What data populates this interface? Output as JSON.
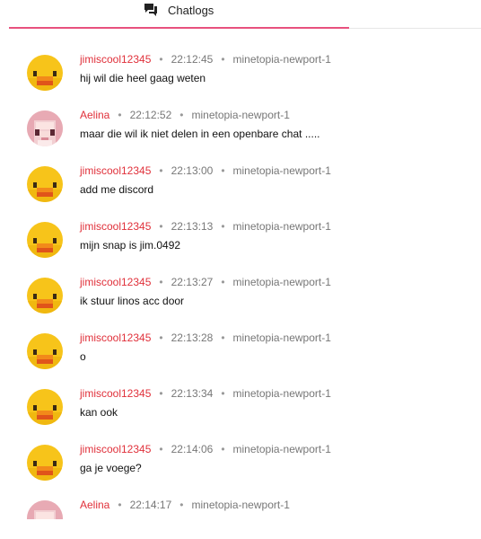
{
  "tab": {
    "label": "Chatlogs",
    "icon": "chat-bubbles-icon",
    "accent": "#e8517e"
  },
  "colors": {
    "username": "#e0303a"
  },
  "messages": [
    {
      "avatar": "duck-avatar",
      "user": "jimiscool12345",
      "time": "22:12:45",
      "server": "minetopia-newport-1",
      "text": "hij wil die heel gaag weten"
    },
    {
      "avatar": "aelina-avatar",
      "user": "Aelina",
      "time": "22:12:52",
      "server": "minetopia-newport-1",
      "text": "maar die wil ik niet delen in een openbare chat ....."
    },
    {
      "avatar": "duck-avatar",
      "user": "jimiscool12345",
      "time": "22:13:00",
      "server": "minetopia-newport-1",
      "text": "add me discord"
    },
    {
      "avatar": "duck-avatar",
      "user": "jimiscool12345",
      "time": "22:13:13",
      "server": "minetopia-newport-1",
      "text": "mijn snap is jim.0492"
    },
    {
      "avatar": "duck-avatar",
      "user": "jimiscool12345",
      "time": "22:13:27",
      "server": "minetopia-newport-1",
      "text": "ik stuur linos acc door"
    },
    {
      "avatar": "duck-avatar",
      "user": "jimiscool12345",
      "time": "22:13:28",
      "server": "minetopia-newport-1",
      "text": "o"
    },
    {
      "avatar": "duck-avatar",
      "user": "jimiscool12345",
      "time": "22:13:34",
      "server": "minetopia-newport-1",
      "text": "kan ook"
    },
    {
      "avatar": "duck-avatar",
      "user": "jimiscool12345",
      "time": "22:14:06",
      "server": "minetopia-newport-1",
      "text": "ga je voege?"
    },
    {
      "avatar": "aelina-avatar",
      "user": "Aelina",
      "time": "22:14:17",
      "server": "minetopia-newport-1",
      "text": ""
    }
  ]
}
